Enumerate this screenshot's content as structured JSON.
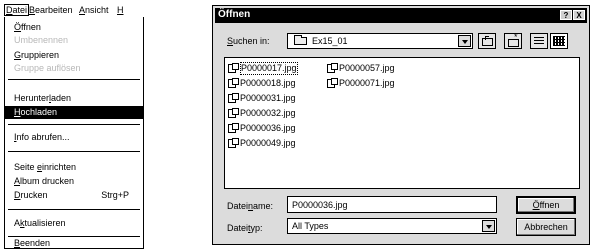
{
  "menu": {
    "bar": [
      {
        "pre": "",
        "key": "D",
        "post": "atei"
      },
      {
        "pre": "",
        "key": "B",
        "post": "earbeiten"
      },
      {
        "pre": "",
        "key": "A",
        "post": "nsicht"
      },
      {
        "pre": "",
        "key": "H",
        "post": ""
      }
    ],
    "items": [
      {
        "pre": "",
        "key": "Ö",
        "post": "ffnen"
      },
      {
        "text": "Umbenennen"
      },
      {
        "pre": "",
        "key": "G",
        "post": "ruppieren"
      },
      {
        "text": "Gruppe auflösen"
      },
      {
        "pre": "Herunter",
        "key": "l",
        "post": "aden"
      },
      {
        "pre": "",
        "key": "H",
        "post": "ochladen"
      },
      {
        "pre": "",
        "key": "I",
        "post": "nfo abrufen..."
      },
      {
        "pre": "Seite ",
        "key": "e",
        "post": "inrichten"
      },
      {
        "pre": "",
        "key": "A",
        "post": "lbum drucken"
      },
      {
        "pre": "",
        "key": "D",
        "post": "rucken",
        "shortcut": "Strg+P"
      },
      {
        "pre": "A",
        "key": "k",
        "post": "tualisieren"
      },
      {
        "pre": "",
        "key": "B",
        "post": "eenden"
      }
    ]
  },
  "dialog": {
    "title": "Öffnen",
    "help_label": "?",
    "close_label": "X",
    "look_in": {
      "pre": "",
      "key": "S",
      "post": "uchen in:",
      "value": "Ex15_01"
    },
    "files": [
      "P0000017.jpg",
      "P0000018.jpg",
      "P0000031.jpg",
      "P0000032.jpg",
      "P0000036.jpg",
      "P0000049.jpg",
      "P0000057.jpg",
      "P0000071.jpg"
    ],
    "filename": {
      "pre": "Datei",
      "key": "n",
      "post": "ame:",
      "value": "P0000036.jpg"
    },
    "filetype": {
      "pre": "Datei",
      "key": "t",
      "post": "yp:",
      "value": "All Types"
    },
    "open_btn": {
      "pre": "",
      "key": "Ö",
      "post": "ffnen"
    },
    "cancel_label": "Abbrechen"
  }
}
